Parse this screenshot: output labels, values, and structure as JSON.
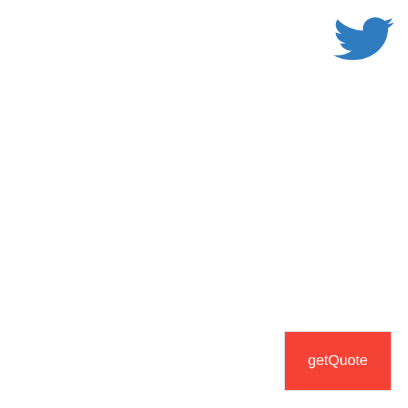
{
  "tweet": {
    "icon": "twitter-bird-icon",
    "color": "#2f7bbf"
  },
  "quote_button": {
    "label": "getQuote",
    "background": "#f44336",
    "text_color": "#ffffff"
  }
}
